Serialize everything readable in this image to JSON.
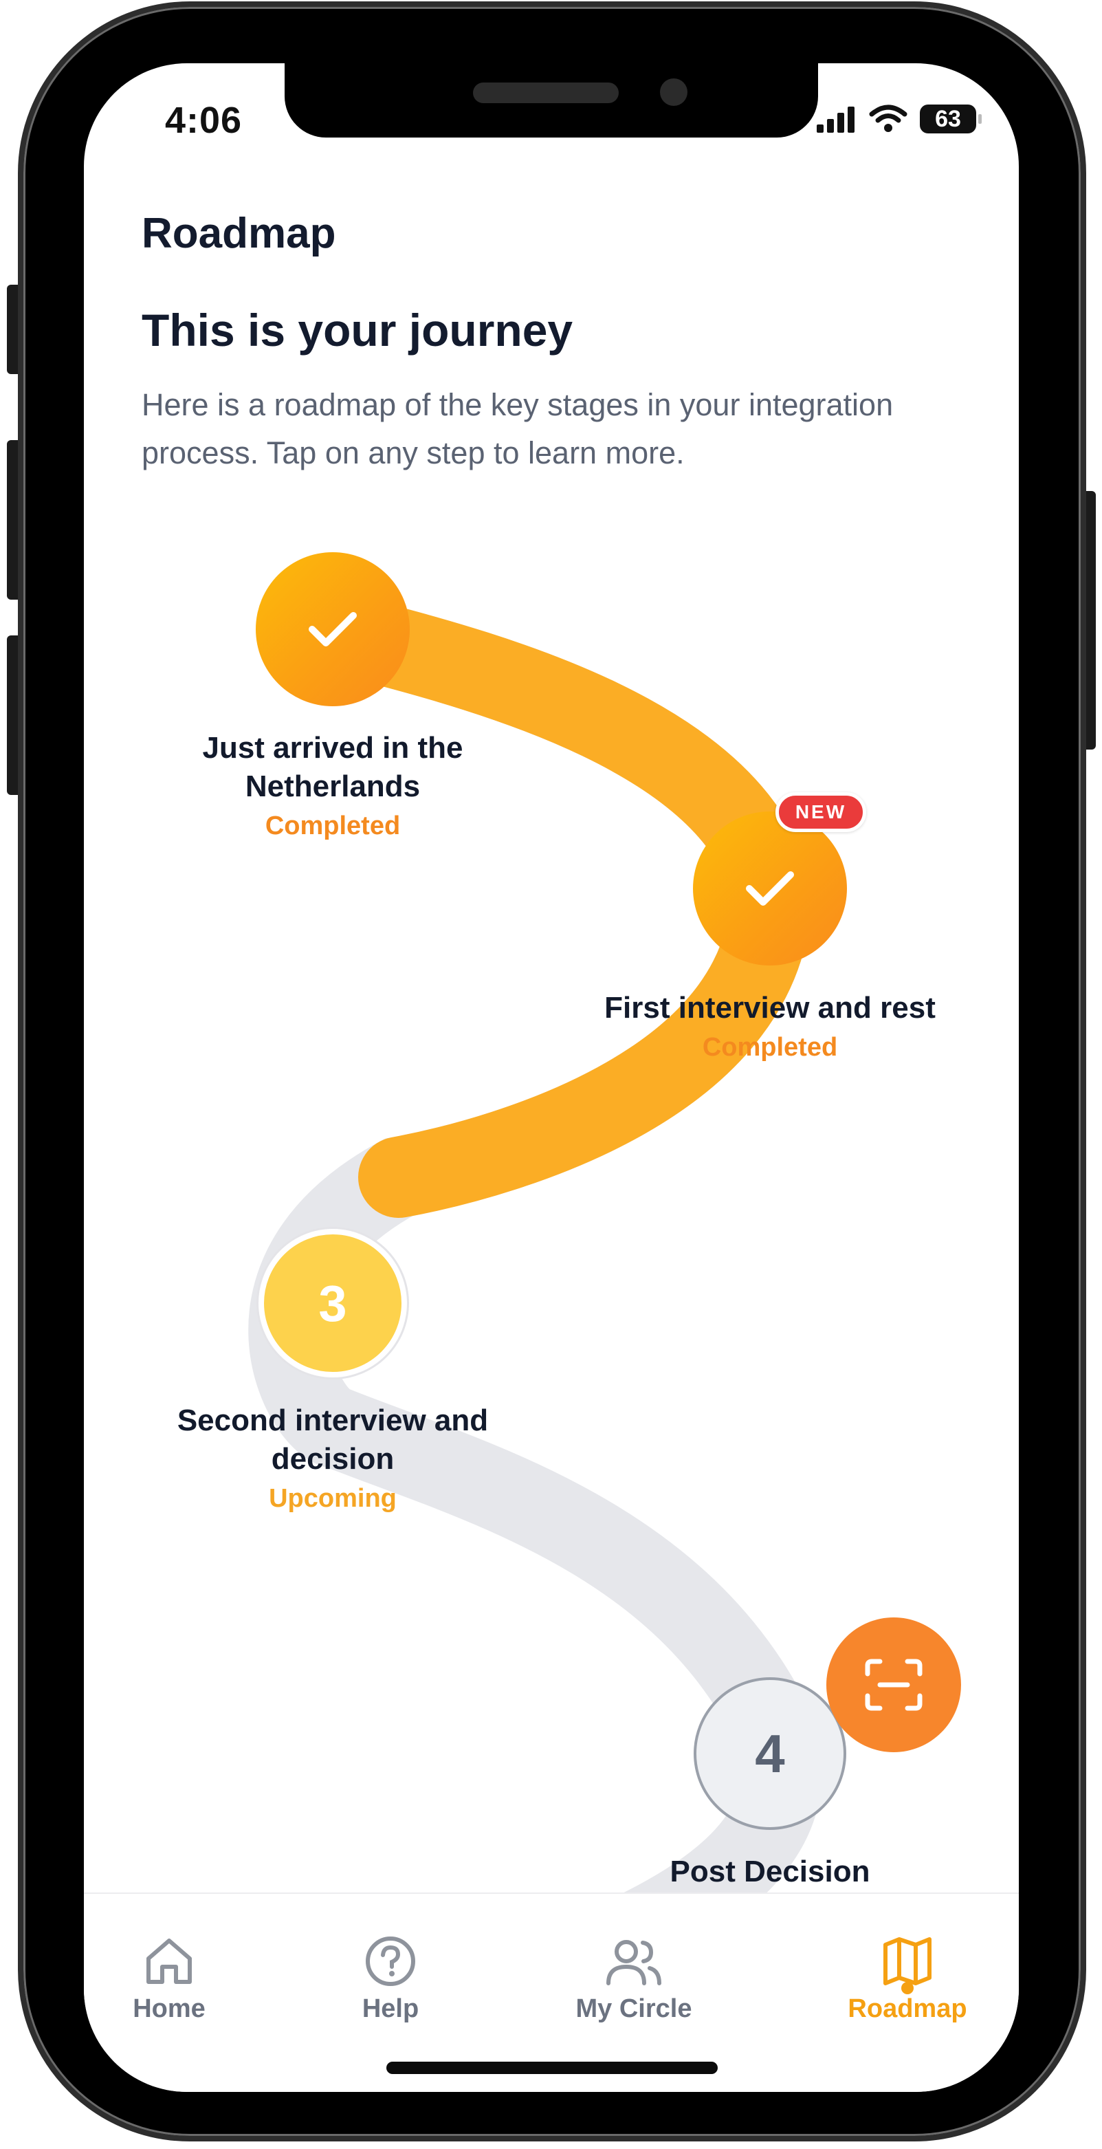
{
  "status_bar": {
    "time": "4:06",
    "battery": "63"
  },
  "header": {
    "title": "Roadmap"
  },
  "journey": {
    "heading": "This is your journey",
    "description": "Here is a roadmap of the key stages in your integration process. Tap on any step to learn more."
  },
  "steps": [
    {
      "title": "Just arrived in the Netherlands",
      "status": "Completed",
      "state": "completed",
      "icon": "check-icon"
    },
    {
      "title": "First interview and rest",
      "status": "Completed",
      "state": "completed",
      "icon": "check-icon",
      "badge": "NEW"
    },
    {
      "number": "3",
      "title": "Second interview and decision",
      "status": "Upcoming",
      "state": "current"
    },
    {
      "number": "4",
      "title": "Post Decision",
      "state": "locked"
    }
  ],
  "fab": {
    "icon": "scan-icon"
  },
  "tabs": [
    {
      "label": "Home",
      "icon": "home-icon",
      "active": false
    },
    {
      "label": "Help",
      "icon": "help-icon",
      "active": false
    },
    {
      "label": "My Circle",
      "icon": "people-icon",
      "active": false
    },
    {
      "label": "Roadmap",
      "icon": "map-icon",
      "active": true
    }
  ],
  "colors": {
    "accent_orange": "#F7862C",
    "road_completed": "#FBAD25",
    "road_upcoming": "#E6E7EB",
    "current_step": "#FDD24C",
    "new_badge": "#EA3B3B",
    "tab_active": "#F5A012",
    "text_dark": "#131B2E",
    "text_muted": "#5A6272"
  }
}
